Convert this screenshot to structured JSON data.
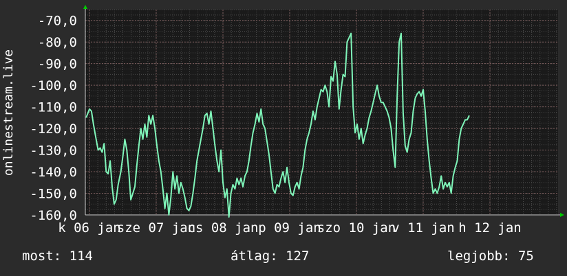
{
  "chart_data": {
    "type": "line",
    "ylabel": "onlinestream.live",
    "ylim": [
      -160,
      -65
    ],
    "yticks": [
      -160,
      -150,
      -140,
      -130,
      -120,
      -110,
      -100,
      -90,
      -80,
      -70
    ],
    "ytick_labels": [
      "-160,0",
      "-150,0",
      "-140,0",
      "-130,0",
      "-120,0",
      "-110,0",
      "-100,0",
      "-90,0",
      "-80,0",
      "-70,0"
    ],
    "xlim": [
      0,
      7
    ],
    "xticks": [
      {
        "x": 0,
        "label": "k 06 jan"
      },
      {
        "x": 1,
        "label": "sze 07 jan"
      },
      {
        "x": 2,
        "label": "cs 08 jan"
      },
      {
        "x": 3,
        "label": "p 09 jan"
      },
      {
        "x": 4,
        "label": "szo 10 jan"
      },
      {
        "x": 5,
        "label": "v 11 jan"
      },
      {
        "x": 6,
        "label": "h 12 jan"
      }
    ],
    "grid": true,
    "colors": {
      "background": "#2b2b2b",
      "plot": "#1a1a1a",
      "line": "#7ff5b9",
      "grid": "#4a4a4a",
      "axis": "#cccccc",
      "arrow": "#00cc00"
    },
    "series": [
      {
        "values": [
          [
            -0.05,
            -115
          ],
          [
            0.0,
            -111
          ],
          [
            0.03,
            -112
          ],
          [
            0.06,
            -118
          ],
          [
            0.1,
            -125
          ],
          [
            0.13,
            -130
          ],
          [
            0.16,
            -129
          ],
          [
            0.19,
            -131
          ],
          [
            0.22,
            -127
          ],
          [
            0.25,
            -140
          ],
          [
            0.28,
            -141
          ],
          [
            0.31,
            -135
          ],
          [
            0.34,
            -147
          ],
          [
            0.37,
            -155
          ],
          [
            0.4,
            -153
          ],
          [
            0.43,
            -146
          ],
          [
            0.47,
            -140
          ],
          [
            0.5,
            -133
          ],
          [
            0.53,
            -125
          ],
          [
            0.56,
            -130
          ],
          [
            0.59,
            -140
          ],
          [
            0.62,
            -153
          ],
          [
            0.65,
            -150
          ],
          [
            0.68,
            -147
          ],
          [
            0.71,
            -137
          ],
          [
            0.74,
            -128
          ],
          [
            0.77,
            -120
          ],
          [
            0.8,
            -125
          ],
          [
            0.83,
            -118
          ],
          [
            0.86,
            -124
          ],
          [
            0.89,
            -114
          ],
          [
            0.92,
            -118
          ],
          [
            0.95,
            -114
          ],
          [
            0.98,
            -120
          ],
          [
            1.01,
            -128
          ],
          [
            1.04,
            -135
          ],
          [
            1.07,
            -140
          ],
          [
            1.1,
            -148
          ],
          [
            1.13,
            -157
          ],
          [
            1.16,
            -150
          ],
          [
            1.19,
            -160
          ],
          [
            1.22,
            -152
          ],
          [
            1.25,
            -140
          ],
          [
            1.28,
            -148
          ],
          [
            1.31,
            -142
          ],
          [
            1.34,
            -150
          ],
          [
            1.37,
            -145
          ],
          [
            1.4,
            -148
          ],
          [
            1.43,
            -152
          ],
          [
            1.46,
            -157
          ],
          [
            1.49,
            -158
          ],
          [
            1.52,
            -156
          ],
          [
            1.55,
            -150
          ],
          [
            1.58,
            -143
          ],
          [
            1.61,
            -135
          ],
          [
            1.64,
            -130
          ],
          [
            1.67,
            -125
          ],
          [
            1.7,
            -120
          ],
          [
            1.73,
            -114
          ],
          [
            1.76,
            -113
          ],
          [
            1.79,
            -118
          ],
          [
            1.82,
            -112
          ],
          [
            1.85,
            -120
          ],
          [
            1.88,
            -128
          ],
          [
            1.91,
            -135
          ],
          [
            1.94,
            -140
          ],
          [
            1.97,
            -130
          ],
          [
            2.0,
            -145
          ],
          [
            2.03,
            -152
          ],
          [
            2.06,
            -148
          ],
          [
            2.09,
            -161
          ],
          [
            2.12,
            -150
          ],
          [
            2.15,
            -146
          ],
          [
            2.18,
            -148
          ],
          [
            2.21,
            -143
          ],
          [
            2.24,
            -146
          ],
          [
            2.27,
            -143
          ],
          [
            2.3,
            -147
          ],
          [
            2.33,
            -142
          ],
          [
            2.36,
            -140
          ],
          [
            2.39,
            -135
          ],
          [
            2.42,
            -128
          ],
          [
            2.45,
            -122
          ],
          [
            2.48,
            -118
          ],
          [
            2.51,
            -113
          ],
          [
            2.54,
            -117
          ],
          [
            2.57,
            -111
          ],
          [
            2.6,
            -118
          ],
          [
            2.63,
            -120
          ],
          [
            2.66,
            -126
          ],
          [
            2.69,
            -132
          ],
          [
            2.72,
            -140
          ],
          [
            2.75,
            -148
          ],
          [
            2.78,
            -150
          ],
          [
            2.81,
            -146
          ],
          [
            2.84,
            -147
          ],
          [
            2.87,
            -143
          ],
          [
            2.9,
            -140
          ],
          [
            2.93,
            -145
          ],
          [
            2.96,
            -138
          ],
          [
            2.99,
            -145
          ],
          [
            3.02,
            -150
          ],
          [
            3.05,
            -151
          ],
          [
            3.08,
            -147
          ],
          [
            3.11,
            -145
          ],
          [
            3.14,
            -148
          ],
          [
            3.17,
            -142
          ],
          [
            3.2,
            -138
          ],
          [
            3.23,
            -130
          ],
          [
            3.26,
            -125
          ],
          [
            3.29,
            -122
          ],
          [
            3.32,
            -118
          ],
          [
            3.35,
            -112
          ],
          [
            3.38,
            -116
          ],
          [
            3.41,
            -110
          ],
          [
            3.44,
            -106
          ],
          [
            3.47,
            -102
          ],
          [
            3.5,
            -103
          ],
          [
            3.53,
            -100
          ],
          [
            3.56,
            -103
          ],
          [
            3.59,
            -110
          ],
          [
            3.62,
            -96
          ],
          [
            3.65,
            -98
          ],
          [
            3.68,
            -89
          ],
          [
            3.71,
            -95
          ],
          [
            3.74,
            -111
          ],
          [
            3.77,
            -102
          ],
          [
            3.8,
            -95
          ],
          [
            3.83,
            -96
          ],
          [
            3.86,
            -80
          ],
          [
            3.89,
            -78
          ],
          [
            3.92,
            -76
          ],
          [
            3.95,
            -110
          ],
          [
            3.98,
            -122
          ],
          [
            4.01,
            -118
          ],
          [
            4.04,
            -125
          ],
          [
            4.07,
            -120
          ],
          [
            4.1,
            -127
          ],
          [
            4.13,
            -123
          ],
          [
            4.16,
            -120
          ],
          [
            4.19,
            -115
          ],
          [
            4.22,
            -112
          ],
          [
            4.25,
            -108
          ],
          [
            4.28,
            -104
          ],
          [
            4.31,
            -100
          ],
          [
            4.34,
            -105
          ],
          [
            4.37,
            -108
          ],
          [
            4.4,
            -108
          ],
          [
            4.43,
            -110
          ],
          [
            4.46,
            -112
          ],
          [
            4.49,
            -115
          ],
          [
            4.52,
            -120
          ],
          [
            4.55,
            -130
          ],
          [
            4.58,
            -138
          ],
          [
            4.61,
            -105
          ],
          [
            4.64,
            -80
          ],
          [
            4.67,
            -76
          ],
          [
            4.7,
            -113
          ],
          [
            4.73,
            -128
          ],
          [
            4.76,
            -131
          ],
          [
            4.79,
            -125
          ],
          [
            4.82,
            -122
          ],
          [
            4.85,
            -112
          ],
          [
            4.88,
            -106
          ],
          [
            4.91,
            -104
          ],
          [
            4.94,
            -103
          ],
          [
            4.97,
            -105
          ],
          [
            5.0,
            -102
          ],
          [
            5.03,
            -112
          ],
          [
            5.06,
            -125
          ],
          [
            5.09,
            -135
          ],
          [
            5.12,
            -143
          ],
          [
            5.15,
            -150
          ],
          [
            5.18,
            -148
          ],
          [
            5.21,
            -150
          ],
          [
            5.24,
            -147
          ],
          [
            5.27,
            -142
          ],
          [
            5.3,
            -148
          ],
          [
            5.33,
            -145
          ],
          [
            5.36,
            -147
          ],
          [
            5.39,
            -145
          ],
          [
            5.42,
            -150
          ],
          [
            5.45,
            -142
          ],
          [
            5.48,
            -138
          ],
          [
            5.51,
            -135
          ],
          [
            5.54,
            -125
          ],
          [
            5.57,
            -120
          ],
          [
            5.6,
            -118
          ],
          [
            5.63,
            -116
          ],
          [
            5.66,
            -116
          ],
          [
            5.69,
            -114
          ]
        ]
      }
    ]
  },
  "stats": {
    "now": "most: 114",
    "avg": "átlag: 127",
    "best": "legjobb: 75"
  }
}
